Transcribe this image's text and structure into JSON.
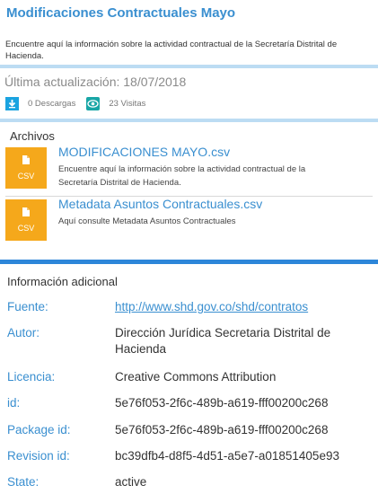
{
  "dataset": {
    "title": "Modificaciones Contractuales Mayo",
    "description": "Encuentre aquí la información sobre la actividad contractual de la Secretaría Distrital de Hacienda.",
    "last_updated": "Última actualización: 18/07/2018",
    "downloads": "0 Descargas",
    "visits": "23 Visitas"
  },
  "files": {
    "heading": "Archivos",
    "items": [
      {
        "name": "MODIFICACIONES MAYO.csv",
        "format": "CSV",
        "description": "Encuentre aquí la información sobre la actividad contractual de la Secretaría Distrital de Hacienda."
      },
      {
        "name": "Metadata Asuntos Contractuales.csv",
        "format": "CSV",
        "description": "Aquí consulte Metadata Asuntos Contractuales"
      }
    ]
  },
  "info": {
    "heading": "Información adicional",
    "rows": [
      {
        "key": "Fuente:",
        "value": "http://www.shd.gov.co/shd/contratos"
      },
      {
        "key": "Autor:",
        "value": "Dirección Jurídica Secretaria Distrital de Hacienda"
      },
      {
        "key": "Licencia:",
        "value": "Creative Commons Attribution"
      },
      {
        "key": "id:",
        "value": "5e76f053-2f6c-489b-a619-fff00200c268"
      },
      {
        "key": "Package id:",
        "value": "5e76f053-2f6c-489b-a619-fff00200c268"
      },
      {
        "key": "Revision id:",
        "value": "bc39dfb4-d8f5-4d51-a5e7-a01851405e93"
      },
      {
        "key": "State:",
        "value": "active"
      }
    ]
  },
  "colors": {
    "accent": "#3a8fd0",
    "file_icon": "#f5a81b",
    "download_icon": "#1aa3e0",
    "eye_icon": "#19a6a6",
    "divider_light": "#bcdcf3",
    "divider_strong": "#2d86d9"
  },
  "icons": {
    "download": "download-icon",
    "visits": "eye-icon",
    "file": "file-csv-icon"
  }
}
